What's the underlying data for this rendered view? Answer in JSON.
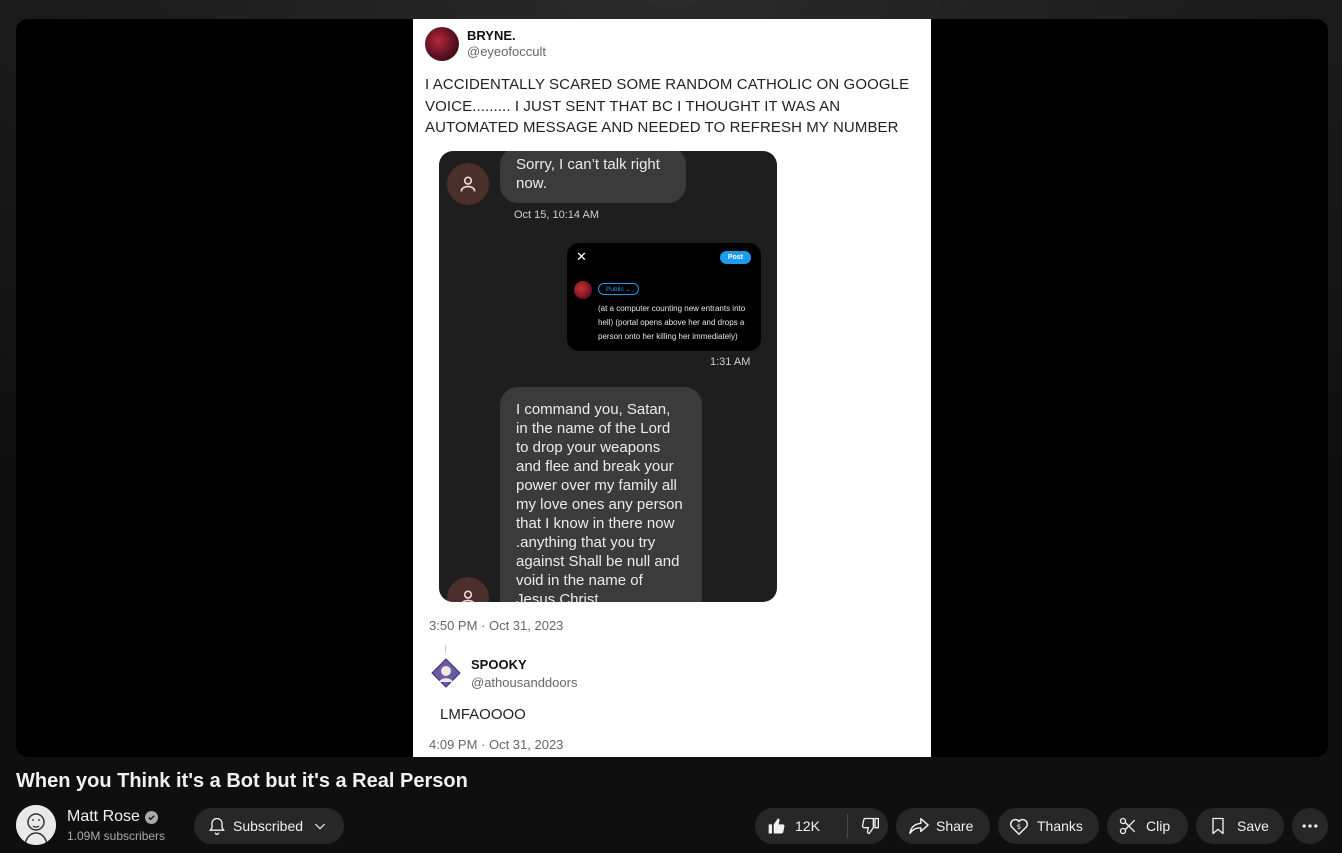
{
  "video": {
    "title": "When you Think it's a Bot but it's a Real Person"
  },
  "tweet": {
    "author_name": "BRYNE.",
    "author_handle": "@eyeofoccult",
    "text": "I ACCIDENTALLY SCARED SOME RANDOM CATHOLIC ON GOOGLE VOICE......... I JUST SENT THAT BC I THOUGHT IT WAS AN AUTOMATED MESSAGE AND NEEDED TO REFRESH MY NUMBER",
    "timestamp": "3:50 PM · Oct 31, 2023",
    "screenshot": {
      "bubble1": "Sorry, I can’t talk right now.",
      "stamp1": "Oct 15, 10:14 AM",
      "post_close": "✕",
      "post_button": "Post",
      "post_audience": "Public ⌄",
      "post_text": "(at a computer counting new entrants into hell) (portal opens above her and drops a person onto her killing her immediately)",
      "stamp2": "1:31 AM",
      "bubble2": "I command you, Satan, in the name of the Lord to drop your weapons and flee and break your power over my family all my love ones any person that I know in there now .anything that you try against Shall be null and void in the name of Jesus Christ"
    }
  },
  "reply": {
    "author_name": "SPOOKY",
    "author_handle": "@athousanddoors",
    "text": "LMFAOOOO",
    "timestamp": "4:09 PM · Oct 31, 2023"
  },
  "channel": {
    "name": "Matt Rose",
    "subscribers": "1.09M subscribers",
    "subscribe_label": "Subscribed"
  },
  "actions": {
    "likes": "12K",
    "share": "Share",
    "thanks": "Thanks",
    "clip": "Clip",
    "save": "Save"
  },
  "icons": [
    "bell-icon",
    "chevron-down-icon",
    "thumbs-up-icon",
    "thumbs-down-icon",
    "share-icon",
    "thanks-icon",
    "scissors-icon",
    "bookmark-icon",
    "more-icon",
    "verified-icon",
    "person-icon"
  ]
}
